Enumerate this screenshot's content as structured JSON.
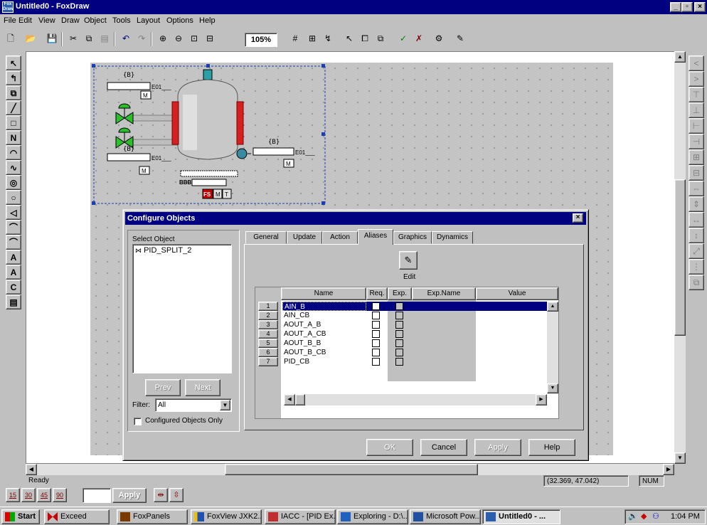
{
  "window": {
    "title": "Untitled0 - FoxDraw"
  },
  "menu": [
    "File",
    "Edit",
    "View",
    "Draw",
    "Object",
    "Tools",
    "Layout",
    "Options",
    "Help"
  ],
  "toolbar": {
    "zoom": "105%"
  },
  "left_tools": [
    "↖",
    "↰",
    "⧉",
    "╱",
    "□",
    "N",
    "◠",
    "∿",
    "◎",
    "○",
    "◁",
    "⌒",
    "⌒",
    "A",
    "A",
    "C",
    "▤"
  ],
  "drawing": {
    "tag_top": "{B}",
    "tag_top_id": "E01___",
    "tag_top_m": "M",
    "tag_mid": "{B}",
    "tag_mid_id": "E01___",
    "tag_mid_m": "M",
    "tag_right": "{B}",
    "tag_right_id": "E01___",
    "tag_right_m": "M",
    "bottom_prefix": "BBB",
    "bottom_fs": "FS",
    "bottom_m": "M",
    "bottom_t": "T"
  },
  "dialog": {
    "title": "Configure Objects",
    "select_label": "Select Object",
    "selected_object": "PID_SPLIT_2",
    "tabs": [
      "General",
      "Update",
      "Action",
      "Aliases",
      "Graphics",
      "Dynamics"
    ],
    "active_tab": "Aliases",
    "edit_label": "Edit",
    "columns": [
      "Name",
      "Req.",
      "Exp.",
      "Exp.Name",
      "Value"
    ],
    "rows": [
      {
        "n": "1",
        "name": "AIN_B"
      },
      {
        "n": "2",
        "name": "AIN_CB"
      },
      {
        "n": "3",
        "name": "AOUT_A_B"
      },
      {
        "n": "4",
        "name": "AOUT_A_CB"
      },
      {
        "n": "5",
        "name": "AOUT_B_B"
      },
      {
        "n": "6",
        "name": "AOUT_B_CB"
      },
      {
        "n": "7",
        "name": "PID_CB"
      }
    ],
    "prev": "Prev",
    "next": "Next",
    "filter_label": "Filter:",
    "filter_value": "All",
    "configured_only": "Configured Objects Only",
    "ok": "OK",
    "cancel": "Cancel",
    "apply": "Apply",
    "help": "Help"
  },
  "status": {
    "text": "Ready",
    "coords": "(32.369, 47.042)",
    "num": "NUM"
  },
  "bottom_tools": {
    "b1": "15",
    "b2": "30",
    "b3": "45",
    "b4": "90",
    "apply": "Apply"
  },
  "taskbar": {
    "start": "Start",
    "tasks": [
      "Exceed",
      "FoxPanels",
      "FoxView JXK2...",
      "IACC - [PID Ex...",
      "Exploring - D:\\...",
      "Microsoft Pow...",
      "Untitled0 - ..."
    ],
    "clock": "1:04 PM"
  }
}
